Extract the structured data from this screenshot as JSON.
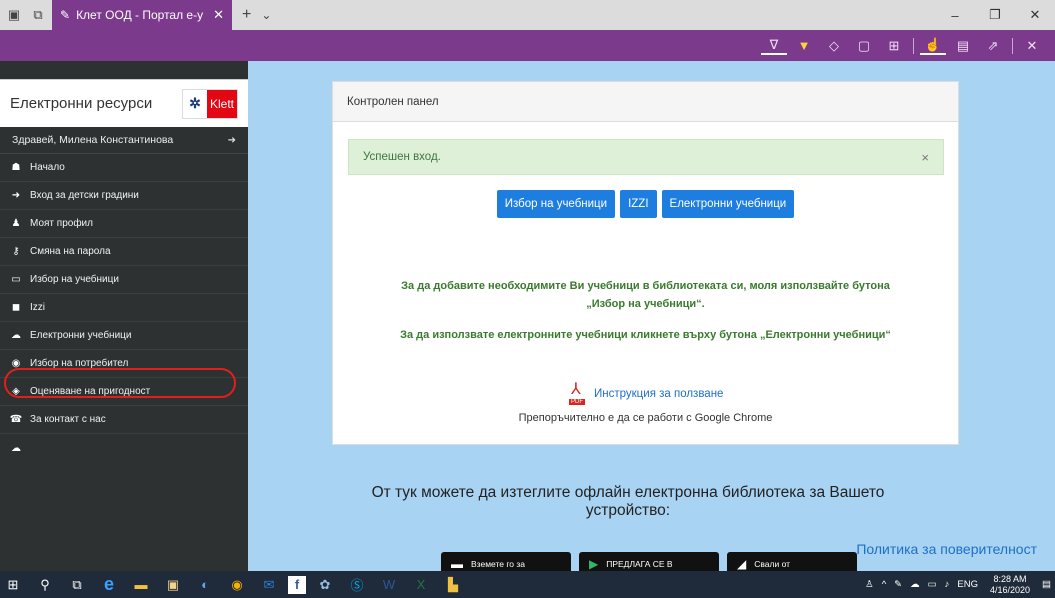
{
  "browser": {
    "tab_title": "Клет ООД - Портал е-у",
    "close_glyph": "✕",
    "new_tab_glyph": "+",
    "chevron_glyph": "⌄",
    "win_min": "–",
    "win_max": "❐",
    "win_close": "✕"
  },
  "sidebar": {
    "brand_title": "Електронни ресурси",
    "logo_mark": "✲",
    "logo_name": "Klett",
    "greeting": "Здравей, Милена Константинова",
    "logout_glyph": "➜",
    "items": [
      {
        "icon": "☗",
        "label": "Начало"
      },
      {
        "icon": "➜",
        "label": "Вход за детски градини"
      },
      {
        "icon": "♟",
        "label": "Моят профил"
      },
      {
        "icon": "⚷",
        "label": "Смяна на парола"
      },
      {
        "icon": "▭",
        "label": "Избор на учебници"
      },
      {
        "icon": "◼",
        "label": "Izzi"
      },
      {
        "icon": "☁",
        "label": "Електронни учебници"
      },
      {
        "icon": "◉",
        "label": "Избор на потребител"
      },
      {
        "icon": "◈",
        "label": "Оценяване на пригодност"
      },
      {
        "icon": "☎",
        "label": "За контакт с нас"
      },
      {
        "icon": "☁",
        "label": ""
      }
    ]
  },
  "panel": {
    "heading": "Контролен панел",
    "alert_text": "Успешен вход.",
    "alert_close": "×",
    "buttons": [
      "Избор на учебници",
      "IZZI",
      "Електронни учебници"
    ],
    "info_line1": "За да добавите необходимите Ви учебници в библиотеката си, моля използвайте бутона",
    "info_line2": "„Избор на учебници“.",
    "info_line3": "За да използвате електронните учебници кликнете върху бутона „Електронни учебници“",
    "pdf_badge": "PDF",
    "instructions_link": "Инструкция за ползване",
    "recommendation": "Препоръчително е да се работи с Google Chrome"
  },
  "offline": {
    "line1": "От тук можете да изтеглите офлайн електронна библиотека за Вашето",
    "line2": "устройство:"
  },
  "policy_link": "Политика за поверителност",
  "stores": {
    "ms": "Вземете го за",
    "gp": "ПРЕДЛАГА СЕ В",
    "ap": "Свали от"
  },
  "taskbar": {
    "lang": "ENG",
    "time": "8:28 AM",
    "date": "4/16/2020"
  },
  "colors": {
    "accent_purple": "#7b3a8c",
    "sidebar_bg": "#2d3132",
    "main_bg": "#a9d3f2",
    "button_blue": "#1e7ee0",
    "alert_green": "#dff0d8",
    "highlight_red": "#e0201a"
  }
}
